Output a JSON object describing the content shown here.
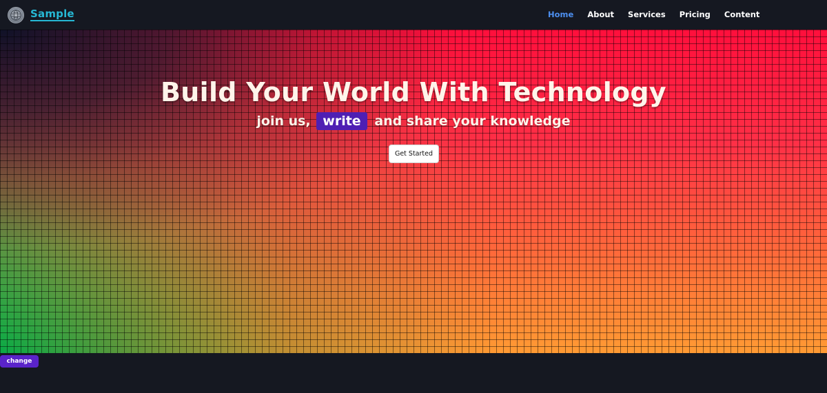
{
  "header": {
    "brand": "Sample",
    "logo_icon": "brain-globe-icon",
    "nav": [
      {
        "label": "Home",
        "active": true
      },
      {
        "label": "About",
        "active": false
      },
      {
        "label": "Services",
        "active": false
      },
      {
        "label": "Pricing",
        "active": false
      },
      {
        "label": "Content",
        "active": false
      }
    ]
  },
  "hero": {
    "title": "Build Your World With Technology",
    "subtitle_before": "join us,",
    "subtitle_highlight": "write",
    "subtitle_after": "and share your knowledge",
    "cta_label": "Get Started"
  },
  "footer": {
    "change_label": "change"
  },
  "colors": {
    "background": "#151821",
    "brand": "#26b8d4",
    "nav_active": "#4d8ff0",
    "highlight": "#4f1fb3",
    "change_button": "#5a23c9"
  }
}
